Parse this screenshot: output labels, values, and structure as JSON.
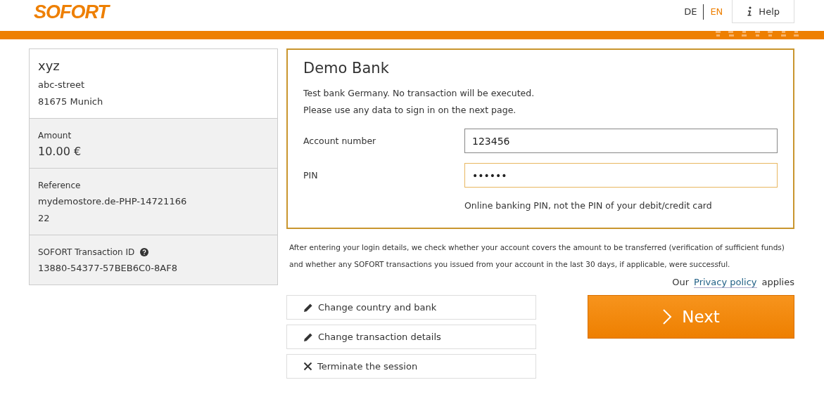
{
  "logo": "SOFORT",
  "languages": [
    {
      "label": "DE",
      "selected": false
    },
    {
      "label": "EN",
      "selected": true
    }
  ],
  "help": "Help",
  "summary": {
    "name": "xyz",
    "street": "abc-street",
    "city": "81675 Munich",
    "sections": [
      {
        "label": "Amount",
        "lines": [
          "10.00 €"
        ],
        "kind": "amount",
        "help": false
      },
      {
        "label": "Reference",
        "lines": [
          "mydemostore.de-PHP-14721166",
          "22"
        ],
        "kind": "plain",
        "help": false
      },
      {
        "label": "SOFORT Transaction ID",
        "lines": [
          "13880-54377-57BEB6C0-8AF8"
        ],
        "kind": "plain",
        "help": true
      }
    ]
  },
  "bank": {
    "title": "Demo Bank",
    "notes": [
      "Test bank Germany. No transaction will be executed.",
      "Please use any data to sign in on the next page."
    ],
    "fields": [
      {
        "label": "Account number",
        "value": "123456",
        "focused": false
      },
      {
        "label": "PIN",
        "value": "••••••",
        "focused": true
      }
    ],
    "hint": "Online banking PIN, not the PIN of your debit/credit card"
  },
  "info": [
    "After entering your login details, we check whether your account covers the amount to be transferred (verification of sufficient funds)",
    "and whether any SOFORT transactions you issued from your account in the last 30 days, if applicable, were successful."
  ],
  "privacy": {
    "before": "Our",
    "link": "Privacy policy",
    "after": "applies"
  },
  "actions": [
    {
      "label": "Change country and bank",
      "kind": "edit"
    },
    {
      "label": "Change transaction details",
      "kind": "edit"
    },
    {
      "label": "Terminate the session",
      "kind": "close"
    }
  ],
  "next": "Next"
}
